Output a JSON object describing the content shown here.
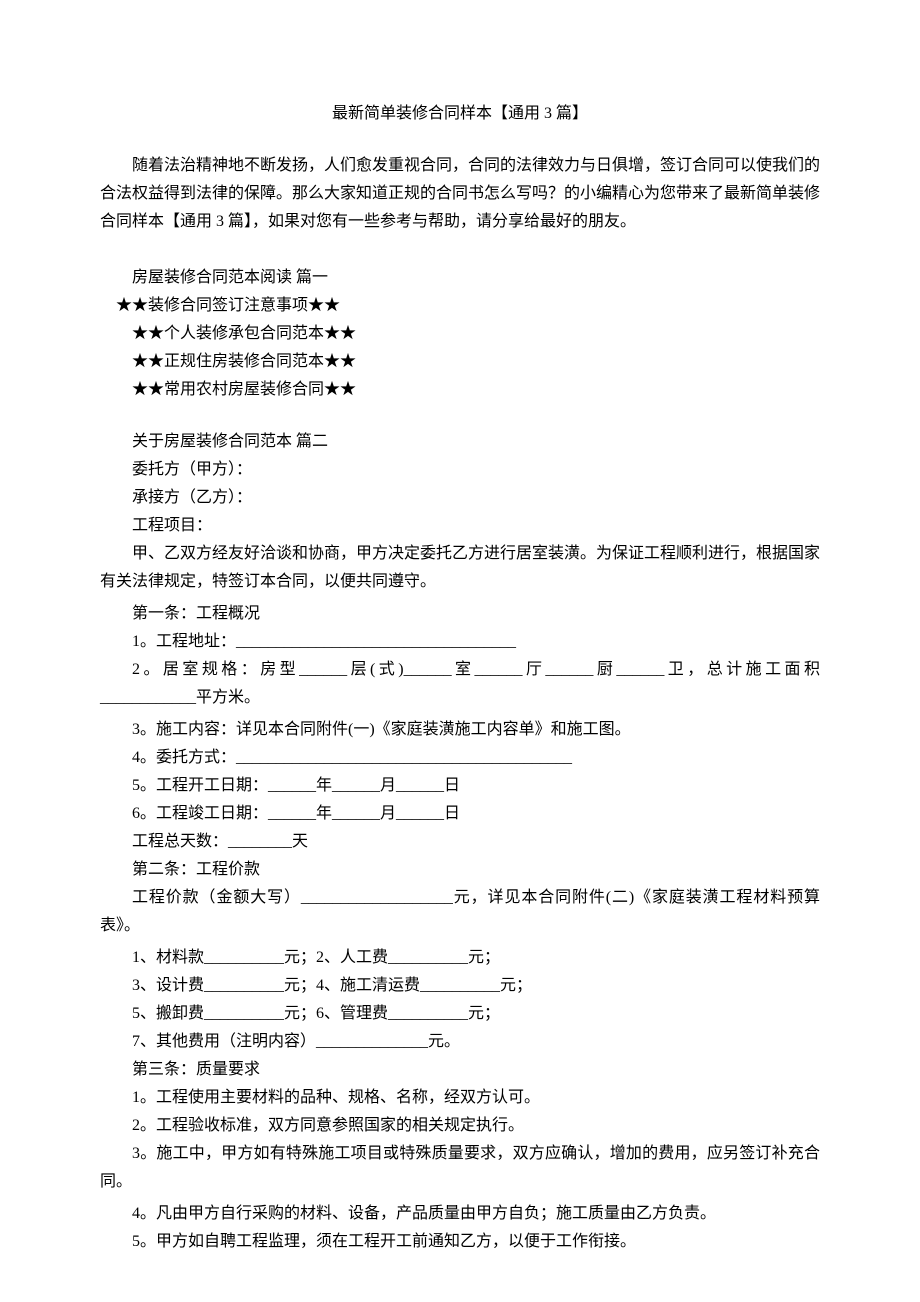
{
  "title": "最新简单装修合同样本【通用 3 篇】",
  "intro": "随着法治精神地不断发扬，人们愈发重视合同，合同的法律效力与日俱增，签订合同可以使我们的合法权益得到法律的保障。那么大家知道正规的合同书怎么写吗？的小编精心为您带来了最新简单装修合同样本【通用 3 篇】，如果对您有一些参考与帮助，请分享给最好的朋友。",
  "section1_title": "房屋装修合同范本阅读 篇一",
  "star_items": [
    "★★装修合同签订注意事项★★",
    "★★个人装修承包合同范本★★",
    "★★正规住房装修合同范本★★",
    "★★常用农村房屋装修合同★★"
  ],
  "section2_title": "关于房屋装修合同范本 篇二",
  "party_a": "委托方（甲方）：",
  "party_b": "承接方（乙方）：",
  "project": "工程项目：",
  "agreement_intro": "甲、乙双方经友好洽谈和协商，甲方决定委托乙方进行居室装潢。为保证工程顺利进行，根据国家有关法律规定，特签订本合同，以便共同遵守。",
  "article1_title": "第一条：工程概况",
  "article1_items": [
    "1。工程地址：___________________________________",
    "2。居室规格：房型______层(式)______室______厅______厨______卫，总计施工面积____________平方米。",
    "3。施工内容：详见本合同附件(一)《家庭装潢施工内容单》和施工图。",
    "4。委托方式：__________________________________________",
    "5。工程开工日期：______年______月______日",
    "6。工程竣工日期：______年______月______日",
    "工程总天数：________天"
  ],
  "article2_title": "第二条：工程价款",
  "article2_price": "工程价款（金额大写）___________________元，详见本合同附件(二)《家庭装潢工程材料预算表》。",
  "article2_items": [
    "1、材料款__________元；2、人工费__________元；",
    "3、设计费__________元；4、施工清运费__________元；",
    "5、搬卸费__________元；6、管理费__________元；",
    "7、其他费用（注明内容）______________元。"
  ],
  "article3_title": "第三条：质量要求",
  "article3_items": [
    "1。工程使用主要材料的品种、规格、名称，经双方认可。",
    "2。工程验收标准，双方同意参照国家的相关规定执行。",
    "3。施工中，甲方如有特殊施工项目或特殊质量要求，双方应确认，增加的费用，应另签订补充合同。",
    "4。凡由甲方自行采购的材料、设备，产品质量由甲方自负；施工质量由乙方负责。",
    "5。甲方如自聘工程监理，须在工程开工前通知乙方，以便于工作衔接。"
  ]
}
